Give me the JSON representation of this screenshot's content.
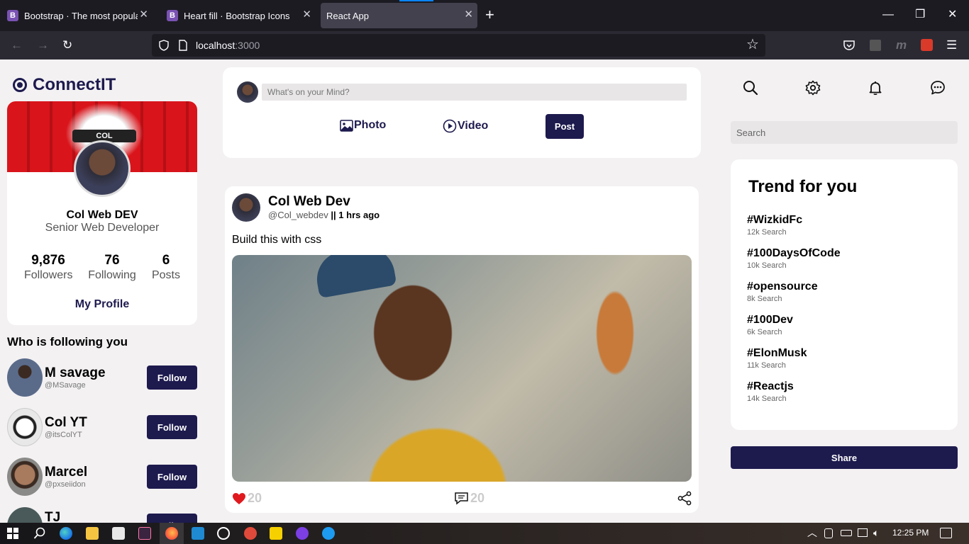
{
  "browser": {
    "tabs": [
      {
        "favicon": "B",
        "title": "Bootstrap · The most popular HTML",
        "close": "✕"
      },
      {
        "favicon": "B",
        "title": "Heart fill · Bootstrap Icons",
        "close": "✕"
      },
      {
        "favicon": "",
        "title": "React App",
        "close": "✕"
      }
    ],
    "new_tab": "+",
    "window_controls": {
      "minimize": "—",
      "restore": "❐",
      "close": "✕"
    },
    "nav": {
      "back": "←",
      "forward": "→",
      "reload": "↻",
      "bookmark": "☆",
      "menu": "☰"
    },
    "url": {
      "host": "localhost",
      "port": ":3000"
    }
  },
  "brand": {
    "name": "ConnectIT"
  },
  "profile": {
    "cover_text": "COL",
    "name": "Col Web DEV",
    "role": "Senior Web Developer",
    "stats": [
      {
        "value": "9,876",
        "label": "Followers"
      },
      {
        "value": "76",
        "label": "Following"
      },
      {
        "value": "6",
        "label": "Posts"
      }
    ],
    "link": "My Profile"
  },
  "followers": {
    "title": "Who is following you",
    "button_label": "Follow",
    "items": [
      {
        "name": "M savage",
        "handle": "@MSavage",
        "avatar_color": "#5a6b8a"
      },
      {
        "name": "Col YT",
        "handle": "@itsColYT",
        "avatar_color": "#e8e8e8"
      },
      {
        "name": "Marcel",
        "handle": "@pxseiidon",
        "avatar_color": "#7a5a4a"
      },
      {
        "name": "TJ",
        "handle": "",
        "avatar_color": "#4a5a5a"
      }
    ]
  },
  "composer": {
    "placeholder": "What's on your Mind?",
    "photo_label": "Photo",
    "video_label": "Video",
    "post_label": "Post"
  },
  "post": {
    "author": "Col Web Dev",
    "handle": "@Col_webdev",
    "separator": "||",
    "time": "1 hrs ago",
    "text": "Build this with css",
    "likes": "20",
    "comments": "20"
  },
  "right": {
    "search_placeholder": "Search",
    "trend_title": "Trend for you",
    "trends": [
      {
        "tag": "#WizkidFc",
        "count": "12k Search"
      },
      {
        "tag": "#100DaysOfCode",
        "count": "10k Search"
      },
      {
        "tag": "#opensource",
        "count": "8k Search"
      },
      {
        "tag": "#100Dev",
        "count": "6k Search"
      },
      {
        "tag": "#ElonMusk",
        "count": "11k Search"
      },
      {
        "tag": "#Reactjs",
        "count": "14k Search"
      }
    ],
    "share_label": "Share"
  },
  "taskbar": {
    "time": "12:25 PM"
  },
  "colors": {
    "accent": "#1d1a4e",
    "like": "#e0191f",
    "background": "#f3f1f2"
  }
}
